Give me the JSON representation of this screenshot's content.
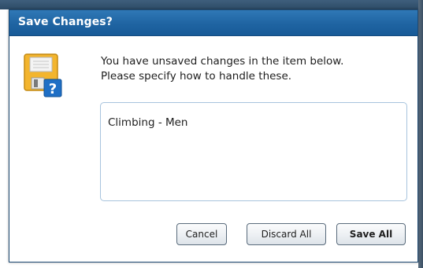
{
  "dialog": {
    "title": "Save Changes?",
    "icon": "save-question-icon",
    "message_line1": "You have unsaved changes in the item below.",
    "message_line2": "Please specify how to handle these.",
    "items": [
      "Climbing - Men"
    ]
  },
  "buttons": {
    "cancel_label": "Cancel",
    "discard_label": "Discard All",
    "save_label": "Save All"
  },
  "colors": {
    "titlebar": "#1f64a2",
    "title_text": "#ffffff",
    "icon_yellow": "#f3b52e",
    "question_badge": "#1f6fc5"
  }
}
